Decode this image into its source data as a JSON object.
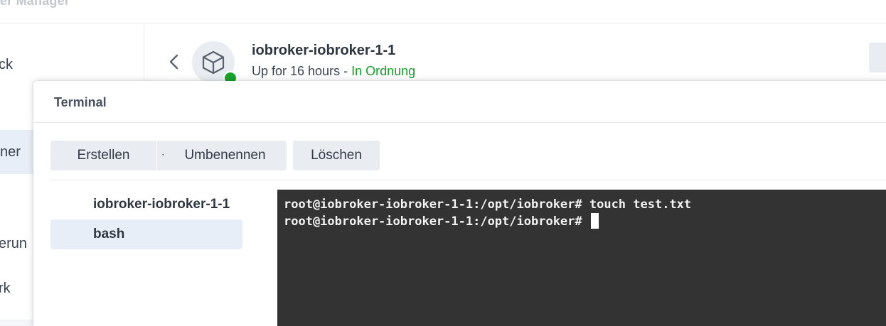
{
  "app": {
    "title": "er Manager"
  },
  "sidebar": {
    "items": [
      {
        "label": "ck",
        "active": false
      },
      {
        "label": "ner",
        "active": true
      },
      {
        "label": "erun",
        "active": false
      },
      {
        "label": "rk",
        "active": false
      }
    ]
  },
  "container": {
    "name": "iobroker-iobroker-1-1",
    "uptime": "Up for 16 hours - ",
    "health": "In Ordnung",
    "status_color": "#1aa32e"
  },
  "dialog": {
    "title": "Terminal",
    "buttons": {
      "create": "Erstellen",
      "rename": "Umbenennen",
      "delete": "Löschen"
    },
    "tree": [
      {
        "label": "iobroker-iobroker-1-1",
        "selected": false
      },
      {
        "label": "bash",
        "selected": true
      }
    ],
    "terminal": {
      "lines": [
        "root@iobroker-iobroker-1-1:/opt/iobroker# touch test.txt",
        "root@iobroker-iobroker-1-1:/opt/iobroker# "
      ],
      "background": "#333333"
    }
  }
}
